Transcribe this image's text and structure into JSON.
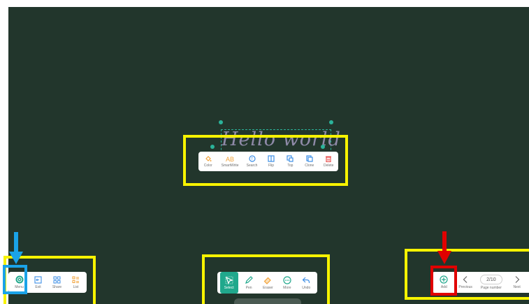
{
  "canvas": {
    "text": "Hello world"
  },
  "context_toolbar": {
    "items": [
      {
        "label": "Color",
        "icon": "paint-bucket-icon",
        "color": "#f2a33a"
      },
      {
        "label": "SmartWrite",
        "icon": "text-recognition-icon",
        "color": "#f2a33a"
      },
      {
        "label": "Search",
        "icon": "search-icon",
        "color": "#3e8fe6"
      },
      {
        "label": "Flip",
        "icon": "flip-icon",
        "color": "#3e8fe6"
      },
      {
        "label": "Top",
        "icon": "bring-to-top-icon",
        "color": "#3e8fe6"
      },
      {
        "label": "Clone",
        "icon": "clone-icon",
        "color": "#3e8fe6"
      },
      {
        "label": "Delete",
        "icon": "delete-icon",
        "color": "#e8504e"
      }
    ]
  },
  "left_toolbar": {
    "items": [
      {
        "label": "Menu",
        "icon": "menu-icon",
        "color": "#20a88c"
      },
      {
        "label": "Exit",
        "icon": "exit-icon",
        "color": "#3e8fe6"
      },
      {
        "label": "Share",
        "icon": "share-icon",
        "color": "#3e8fe6"
      },
      {
        "label": "List",
        "icon": "list-icon",
        "color": "#f2a33a"
      }
    ]
  },
  "center_toolbar": {
    "items": [
      {
        "label": "Select",
        "icon": "select-cursor-icon",
        "selected": true
      },
      {
        "label": "Pen",
        "icon": "pen-icon",
        "color": "#20a88c"
      },
      {
        "label": "Eraser",
        "icon": "eraser-icon",
        "color": "#f2a33a"
      },
      {
        "label": "More",
        "icon": "more-icon",
        "color": "#20a88c"
      },
      {
        "label": "Undo",
        "icon": "undo-icon",
        "color": "#3e8fe6"
      }
    ]
  },
  "right_toolbar": {
    "add_label": "Add",
    "previous_label": "Previous",
    "page_number": "2/10",
    "page_number_label": "Page number",
    "next_label": "Next"
  },
  "colors": {
    "board": "#22362c",
    "highlight_yellow": "#f7f300",
    "highlight_blue": "#1aa3e8",
    "highlight_red": "#e00000",
    "accent": "#20a88c"
  }
}
